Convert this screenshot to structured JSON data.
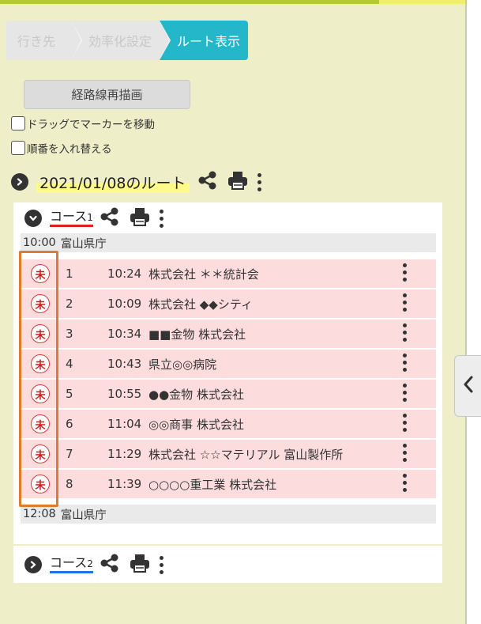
{
  "steps": [
    {
      "label": "行き先",
      "active": false
    },
    {
      "label": "効率化設定",
      "active": false
    },
    {
      "label": "ルート表示",
      "active": true
    }
  ],
  "toolbar": {
    "redraw_label": "経路線再描画",
    "drag_marker_label": "ドラッグでマーカーを移動",
    "reorder_label": "順番を入れ替える"
  },
  "route": {
    "title": "2021/01/08のルート"
  },
  "courses": [
    {
      "name": "コース",
      "index": "1",
      "underline_color": "#e02020",
      "start": {
        "time": "10:00",
        "place": "富山県庁"
      },
      "stops": [
        {
          "status": "未",
          "num": "1",
          "time": "10:24",
          "name": "株式会社 ＊＊統計会"
        },
        {
          "status": "未",
          "num": "2",
          "time": "10:09",
          "name": "株式会社 ◆◆シティ"
        },
        {
          "status": "未",
          "num": "3",
          "time": "10:34",
          "name": "■■金物 株式会社"
        },
        {
          "status": "未",
          "num": "4",
          "time": "10:43",
          "name": "県立◎◎病院"
        },
        {
          "status": "未",
          "num": "5",
          "time": "10:55",
          "name": "●●金物 株式会社"
        },
        {
          "status": "未",
          "num": "6",
          "time": "11:04",
          "name": "◎◎商事 株式会社"
        },
        {
          "status": "未",
          "num": "7",
          "time": "11:29",
          "name": "株式会社 ☆☆マテリアル 富山製作所"
        },
        {
          "status": "未",
          "num": "8",
          "time": "11:39",
          "name": "○○○○重工業 株式会社"
        }
      ],
      "end": {
        "time": "12:08",
        "place": "富山県庁"
      }
    },
    {
      "name": "コース",
      "index": "2",
      "underline_color": "#1a73e8"
    }
  ],
  "colors": {
    "active_step": "#23b7c9",
    "page_background": "#eeeec9",
    "stop_row": "#fcdcdc",
    "status_badge": "#d93a3a",
    "highlight_box": "#e07a2e"
  },
  "icons": {
    "expand": "chevron-right-circle-icon",
    "collapse": "chevron-down-circle-icon",
    "share": "share-icon",
    "print": "printer-icon",
    "more": "kebab-menu-icon",
    "panel_toggle": "chevron-left-icon"
  }
}
